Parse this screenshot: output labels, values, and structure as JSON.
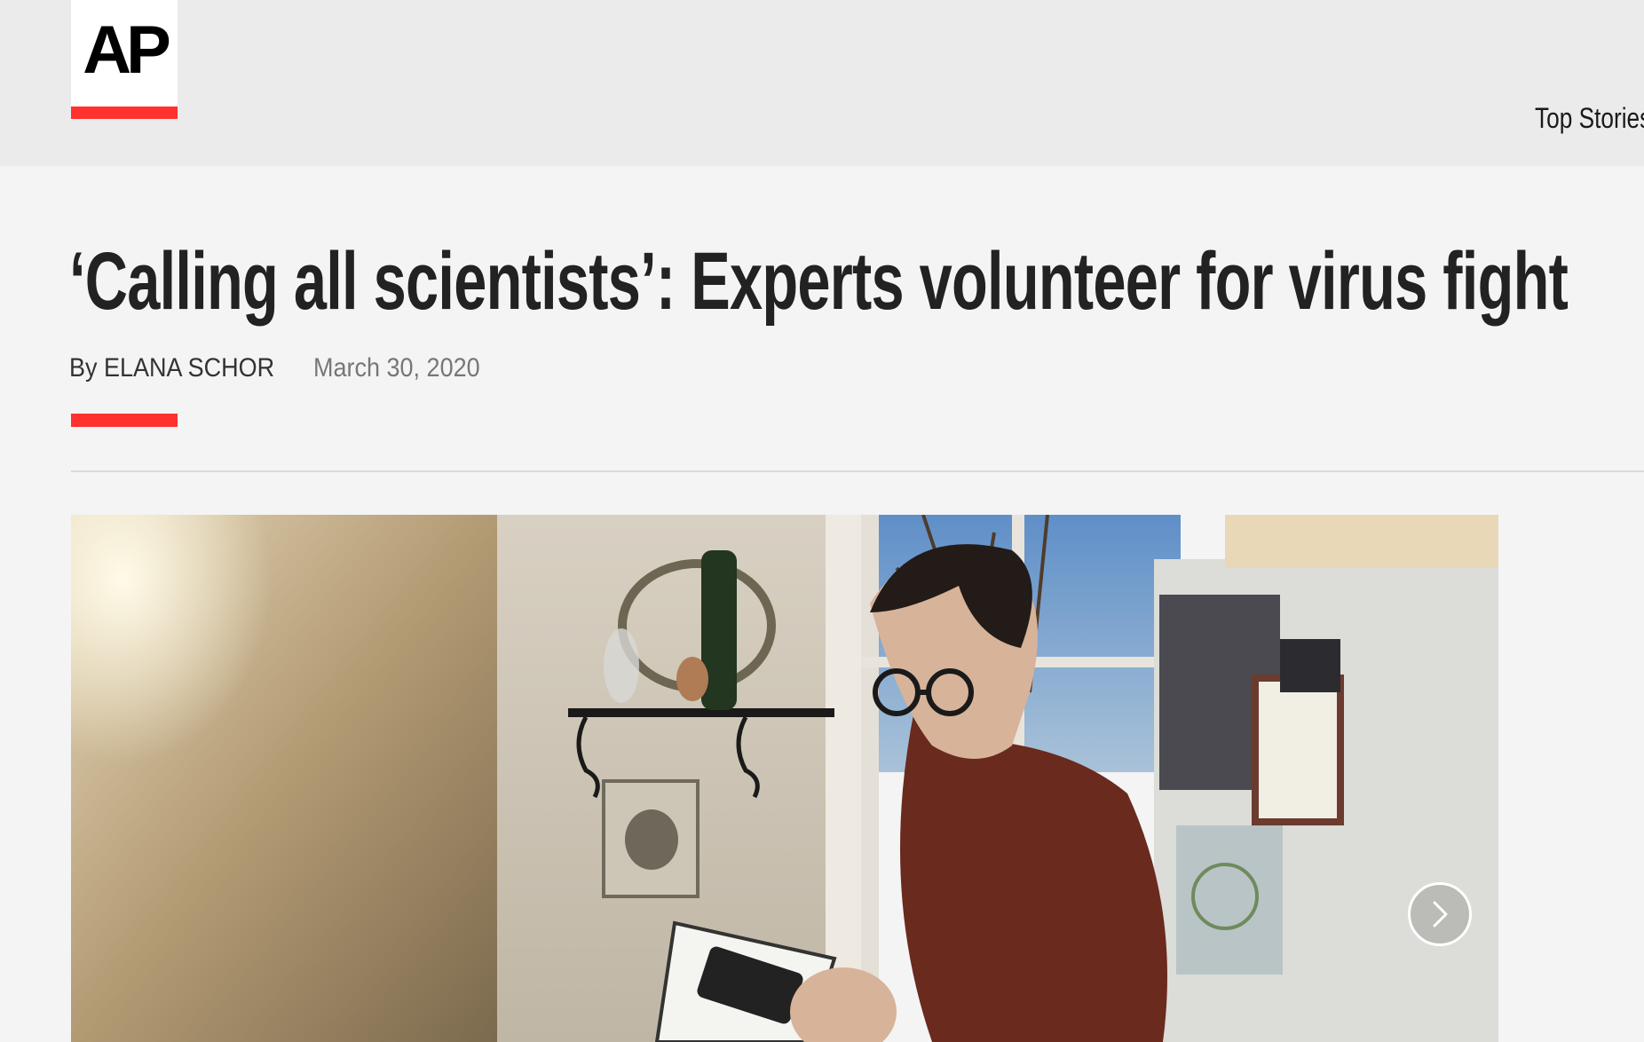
{
  "header": {
    "logo_text": "AP",
    "nav_item": "Top Stories"
  },
  "article": {
    "headline": "‘Calling all scientists’: Experts volunteer for virus fight",
    "byline": "By ELANA SCHOR",
    "date": "March 30, 2020"
  },
  "photo": {
    "next_icon": "chevron-right-icon"
  },
  "colors": {
    "accent": "#ff322e",
    "header_bg": "#ebebeb",
    "page_bg": "#f4f4f4",
    "text": "#222222"
  }
}
